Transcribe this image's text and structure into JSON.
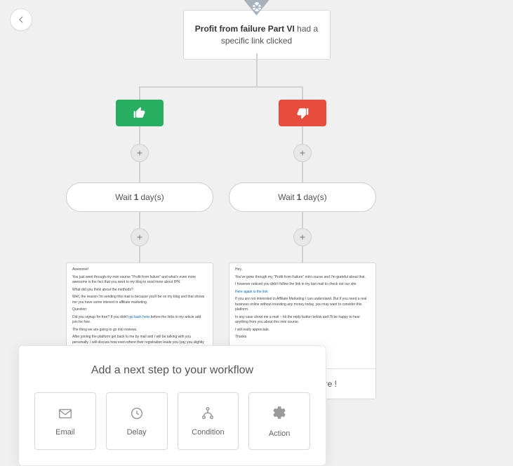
{
  "trigger": {
    "title": "Profit from failure Part VI",
    "suffix": " had a specific link clicked"
  },
  "left": {
    "wait_prefix": "Wait ",
    "wait_n": "1",
    "wait_suffix": " day(s)",
    "email_preview": "Awesome!\nYou just went through my mini course \"Profit from failure\" and what's even more awesome is the fact that you went to my blog to read more about IPN.\nWhat did you think about the methods?\nWell, the reason I'm sending this mail is because you'll be on my blog and that shows me you have some interest in affiliate marketing.\nQuestion:\nDid you signup for free? If you didn't go back here before the links in my article add join for free.\nThe thing we are going to go into reviews.\nAfter joining the platform get back to me by mail and I will be talking with you personally. I will discuss how even where their registration leads you (say you slightly boost your online income).\nI want to hear from you.\nWarmest regards",
    "email_link": "go back here"
  },
  "right": {
    "wait_prefix": "Wait ",
    "wait_n": "1",
    "wait_suffix": " day(s)",
    "email_preview": "Hey,\nYou've gone through my \"Profit from Failure\" mini course and I'm grateful about that.\nI however noticed you didn't follow the link in my last mail to check out our site.\nHere again is the link\nIf you are not interested in Affiliate Marketing I can understand. But if you need a real business online without investing any money today, you may want to consider this platform.\nIn any case shoot me a mail – hit the reply button below and I'll be happy to hear anything from you about this mini course.\nI will really appreciate.\nThanks\nENSTINE MUKI | Founder\nYou will not want to unsubscribe if you want to make profit",
    "link_text": "Here again is the link",
    "subject": "Profit from failure !"
  },
  "modal": {
    "title": "Add a next step to your workflow",
    "options": {
      "email": "Email",
      "delay": "Delay",
      "condition": "Condition",
      "action": "Action"
    }
  }
}
